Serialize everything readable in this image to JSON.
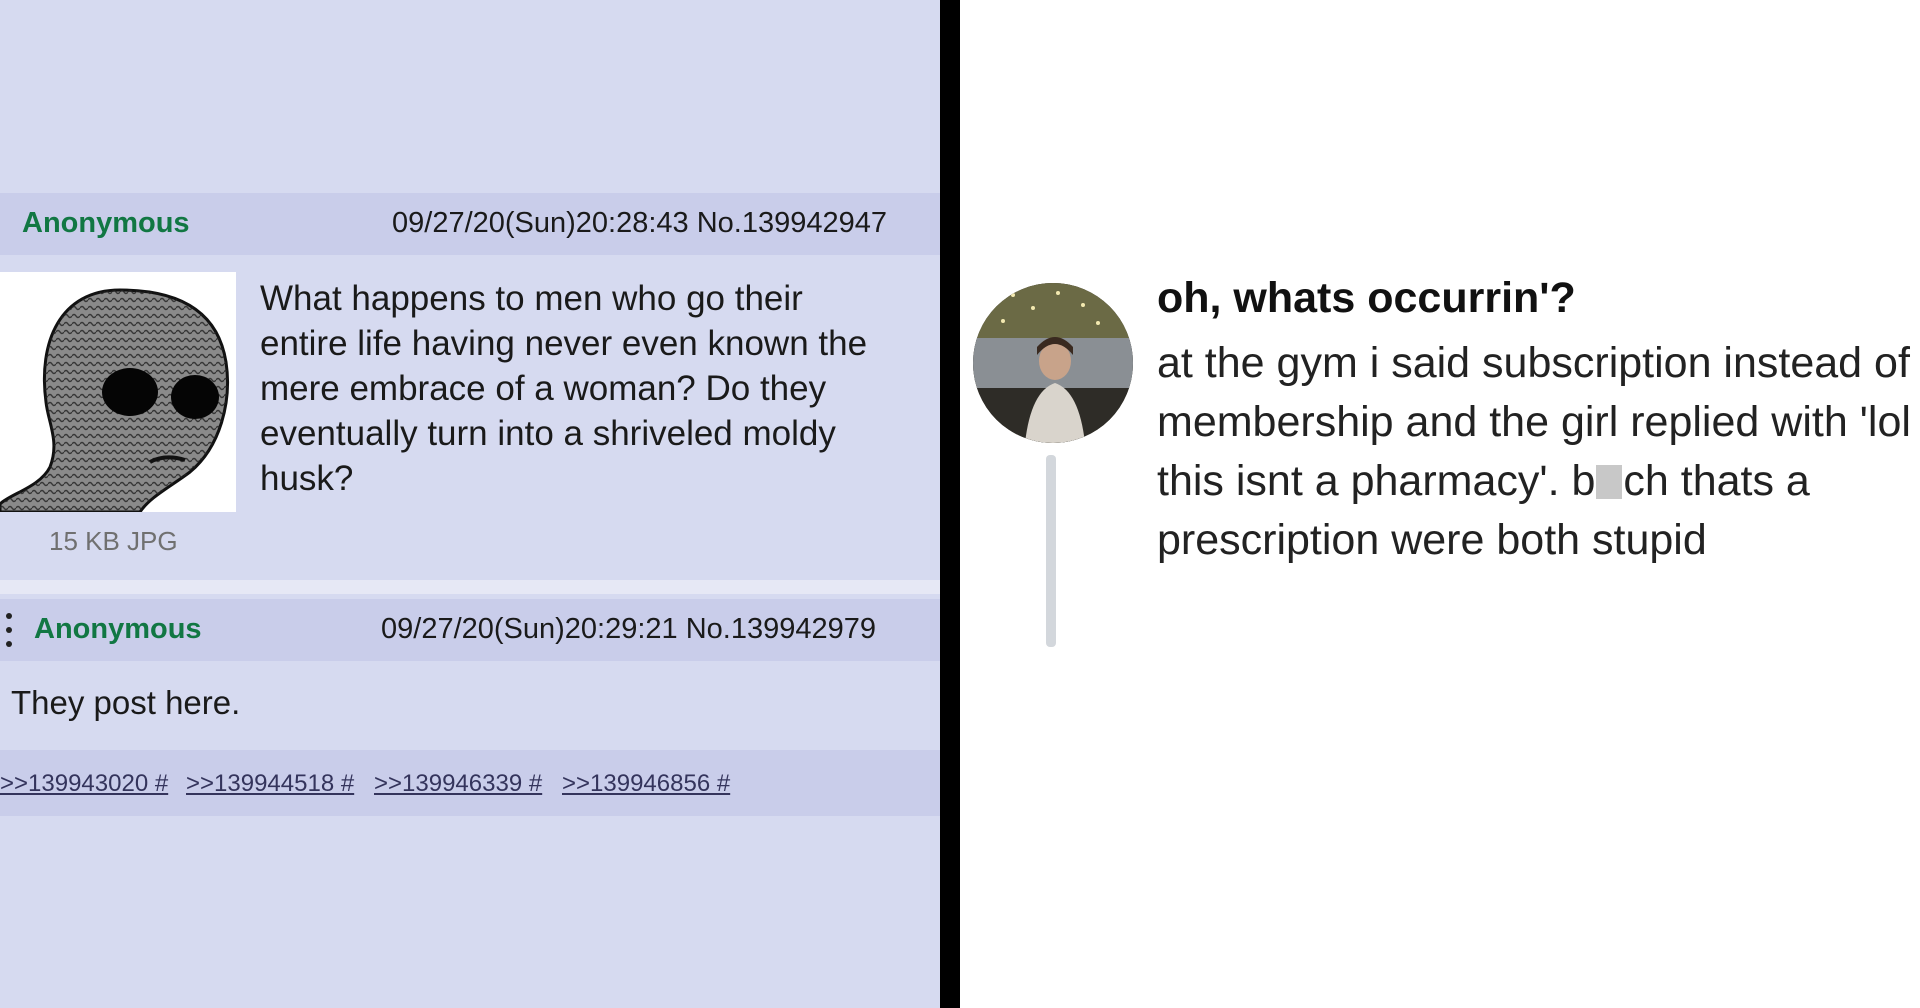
{
  "left_panel": {
    "op": {
      "name": "Anonymous",
      "meta": "09/27/20(Sun)20:28:43 No.139942947",
      "file_info": "15 KB JPG",
      "body": "What happens to men who go their entire life having never even known the mere embrace of a woman? Do they eventually turn into a shriveled moldy husk?"
    },
    "reply": {
      "name": "Anonymous",
      "meta": "09/27/20(Sun)20:29:21 No.139942979",
      "body": "They post here."
    },
    "backlinks": [
      ">>139943020 #",
      ">>139944518 #",
      ">>139946339 #",
      ">>139946856 #"
    ]
  },
  "right_panel": {
    "username": "oh, whats occurrin'?",
    "text_before_censor": "at the gym i said subscription instead of membership and the girl replied with 'lol this isnt a pharmacy'. b",
    "text_after_censor": "ch thats a prescription were both stupid"
  },
  "colors": {
    "board_background": "#d6daf0",
    "header_background": "#c9cdea",
    "name_green": "#117743",
    "link_color": "#34345c",
    "separator": "#000000"
  }
}
